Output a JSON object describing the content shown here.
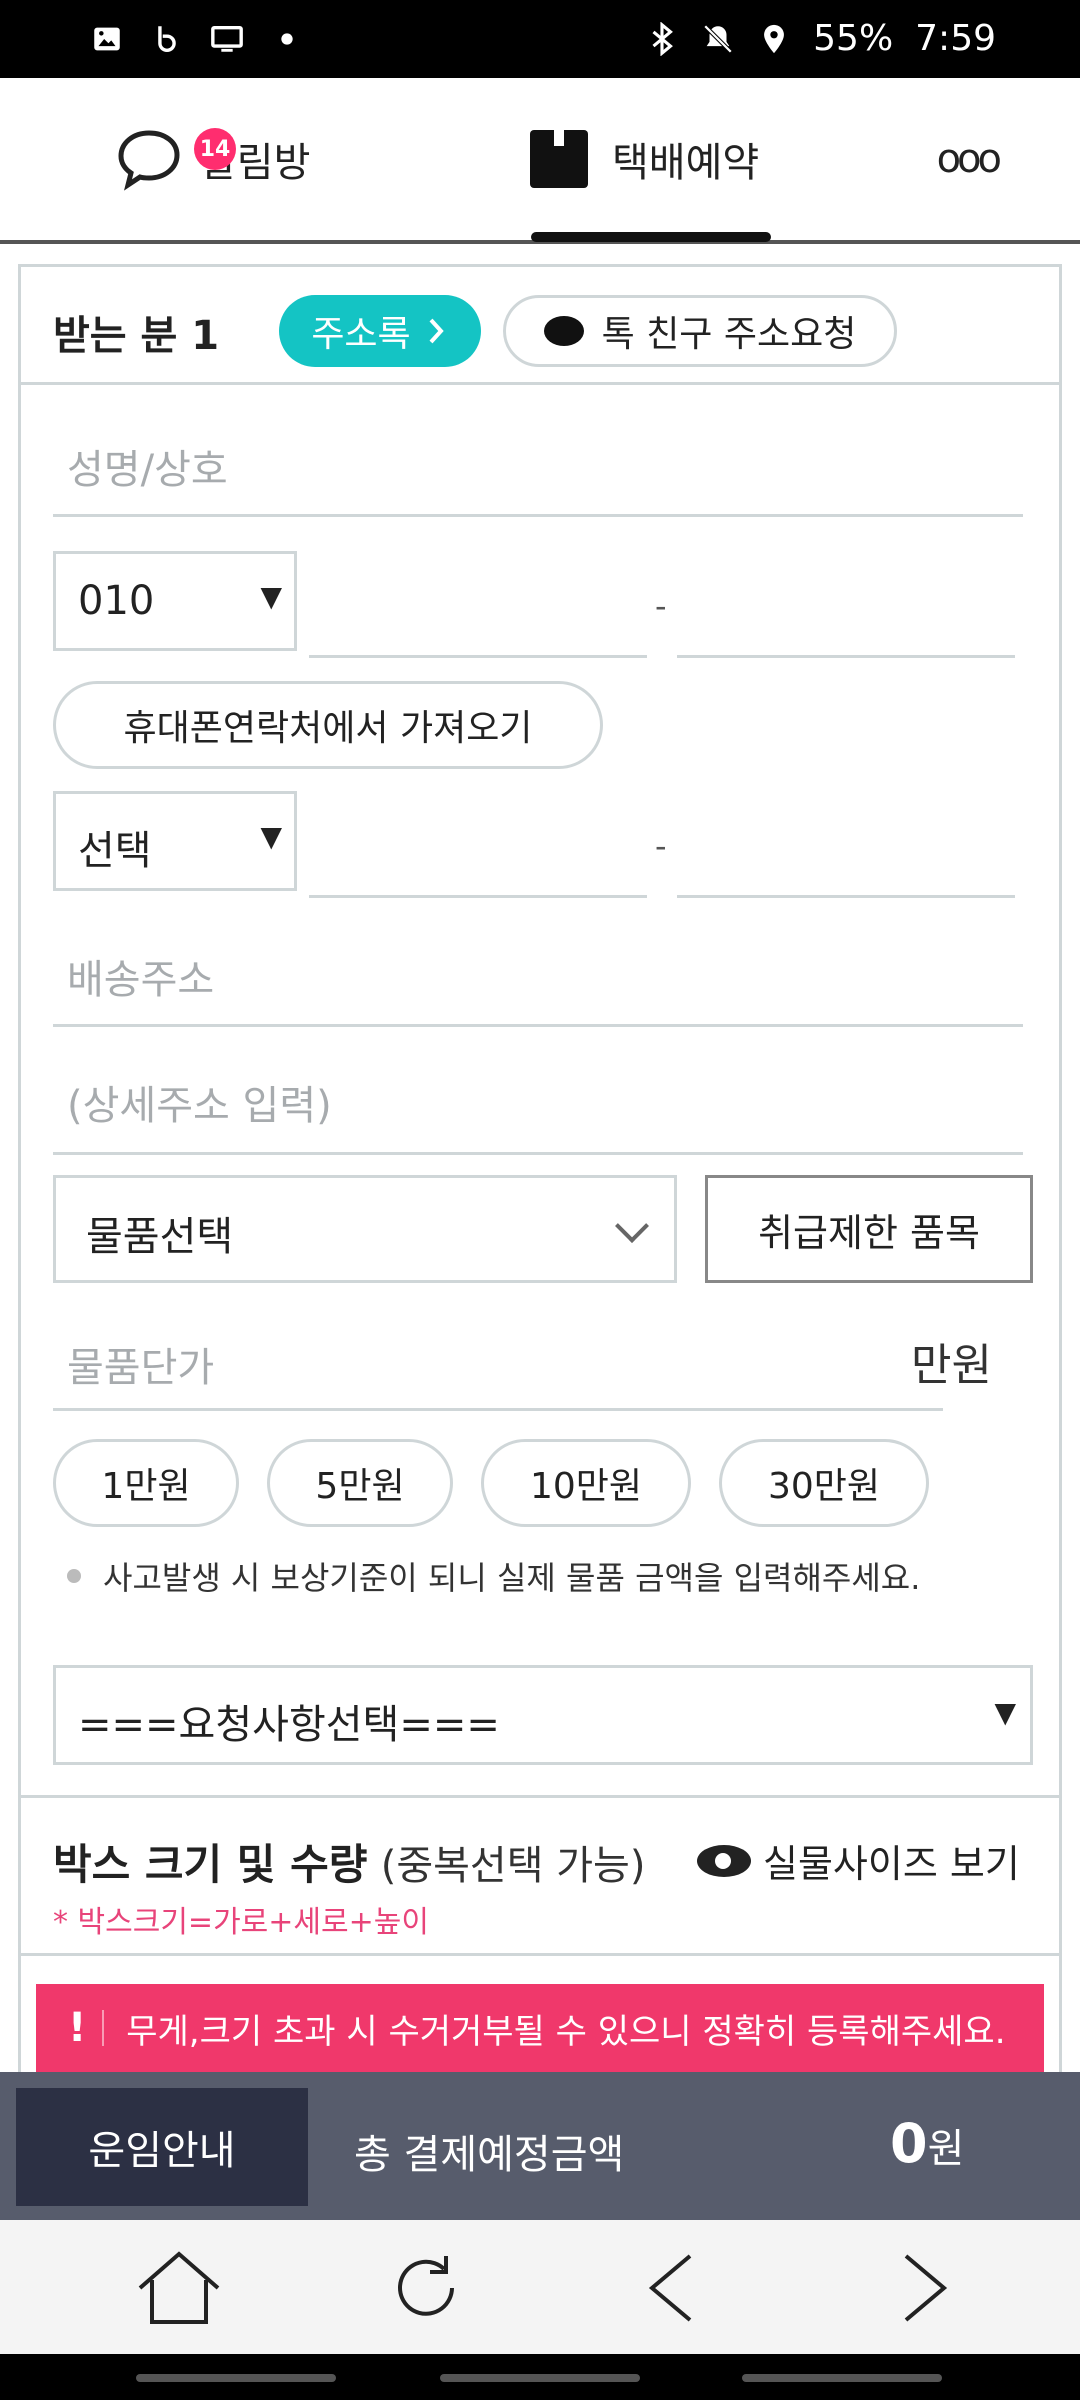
{
  "status_bar": {
    "left_icons": [
      "image-icon",
      "b-app-icon",
      "monitor-icon",
      "dot-icon"
    ],
    "right_icons": [
      "bluetooth-icon",
      "mute-icon",
      "location-icon"
    ],
    "battery": "55%",
    "time": "7:59"
  },
  "top_nav": {
    "alarm_label": "알림방",
    "alarm_badge": "14",
    "delivery_label": "택배예약",
    "more_label": "ooo"
  },
  "receiver": {
    "title": "받는 분 1",
    "address_book_label": "주소록",
    "talk_friend_label": "톡 친구 주소요청",
    "name_placeholder": "성명/상호",
    "phone1_prefix": "010",
    "phone_dash": "-",
    "import_contacts_label": "휴대폰연락처에서 가져오기",
    "phone2_prefix": "선택",
    "address_placeholder": "배송주소",
    "detail_address_placeholder": "(상세주소 입력)",
    "item_select_label": "물품선택",
    "restricted_items_label": "취급제한 품목",
    "price_placeholder": "물품단가",
    "price_unit": "만원",
    "price_presets": [
      "1만원",
      "5만원",
      "10만원",
      "30만원"
    ],
    "price_notice": "사고발생 시 보상기준이 되니 실제 물품 금액을 입력해주세요.",
    "request_select_label": "===요청사항선택==="
  },
  "box_section": {
    "title": "박스 크기 및 수량",
    "subtitle": "(중복선택 가능)",
    "view_size_label": "실물사이즈 보기",
    "size_note": "* 박스크기=가로+세로+높이",
    "warning": "무게,크기 초과 시 수거거부될 수 있으니 정확히 등록해주세요.",
    "warning_mark": "!"
  },
  "pay_bar": {
    "fee_info_label": "운임안내",
    "total_label": "총 결제예정금액",
    "total_amount": "0",
    "currency": "원"
  },
  "browser_nav": {
    "icons": [
      "home-icon",
      "refresh-icon",
      "back-icon",
      "forward-icon"
    ]
  },
  "colors": {
    "accent_teal": "#14c4c4",
    "badge_pink": "#ff2d6f",
    "warning_red": "#f0386b",
    "pay_bar": "#575c6c",
    "fee_button": "#2c3044"
  }
}
